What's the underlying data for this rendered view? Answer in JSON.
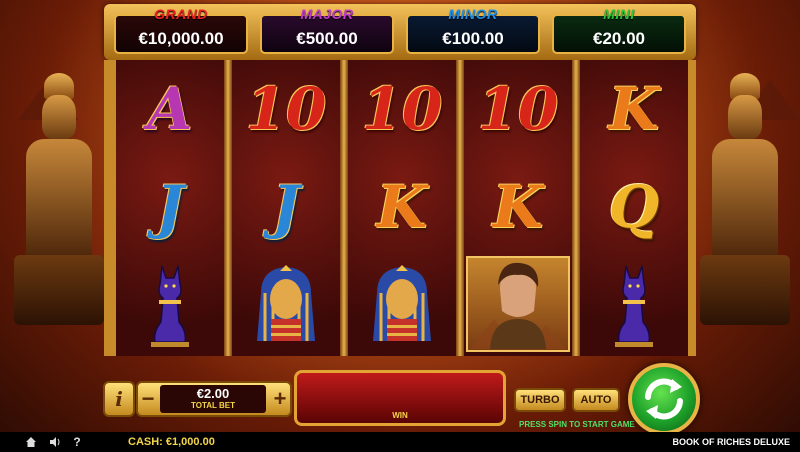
{
  "jackpots": [
    {
      "label": "GRAND",
      "value": "€10,000.00",
      "color": "#e8231f"
    },
    {
      "label": "MAJOR",
      "value": "€500.00",
      "color": "#c13cc7"
    },
    {
      "label": "MINOR",
      "value": "€100.00",
      "color": "#1e90e8"
    },
    {
      "label": "MINI",
      "value": "€20.00",
      "color": "#2fc23a"
    }
  ],
  "reels": [
    [
      {
        "symbol": "A",
        "style": "purple"
      },
      {
        "symbol": "J",
        "style": "blue"
      },
      {
        "symbol": "bastet-cat",
        "style": "icon"
      }
    ],
    [
      {
        "symbol": "10",
        "style": "red"
      },
      {
        "symbol": "J",
        "style": "blue"
      },
      {
        "symbol": "pharaoh-mask",
        "style": "icon"
      }
    ],
    [
      {
        "symbol": "10",
        "style": "red"
      },
      {
        "symbol": "K",
        "style": "orange"
      },
      {
        "symbol": "pharaoh-mask",
        "style": "icon"
      }
    ],
    [
      {
        "symbol": "10",
        "style": "red"
      },
      {
        "symbol": "K",
        "style": "orange"
      },
      {
        "symbol": "explorer",
        "style": "icon"
      }
    ],
    [
      {
        "symbol": "K",
        "style": "orange"
      },
      {
        "symbol": "Q",
        "style": "golden-q"
      },
      {
        "symbol": "bastet-cat",
        "style": "icon"
      }
    ]
  ],
  "controls": {
    "info": "i",
    "minus": "−",
    "plus": "+",
    "bet_value": "€2.00",
    "bet_label": "TOTAL BET",
    "win_label": "WIN",
    "turbo": "TURBO",
    "auto": "AUTO",
    "hint": "PRESS SPIN TO START GAME"
  },
  "footer": {
    "cash": "CASH: €1,000.00",
    "game_title": "BOOK OF RICHES DELUXE"
  },
  "colors": {
    "gold": "#e8b445",
    "spin_green": "#1ea12a"
  }
}
